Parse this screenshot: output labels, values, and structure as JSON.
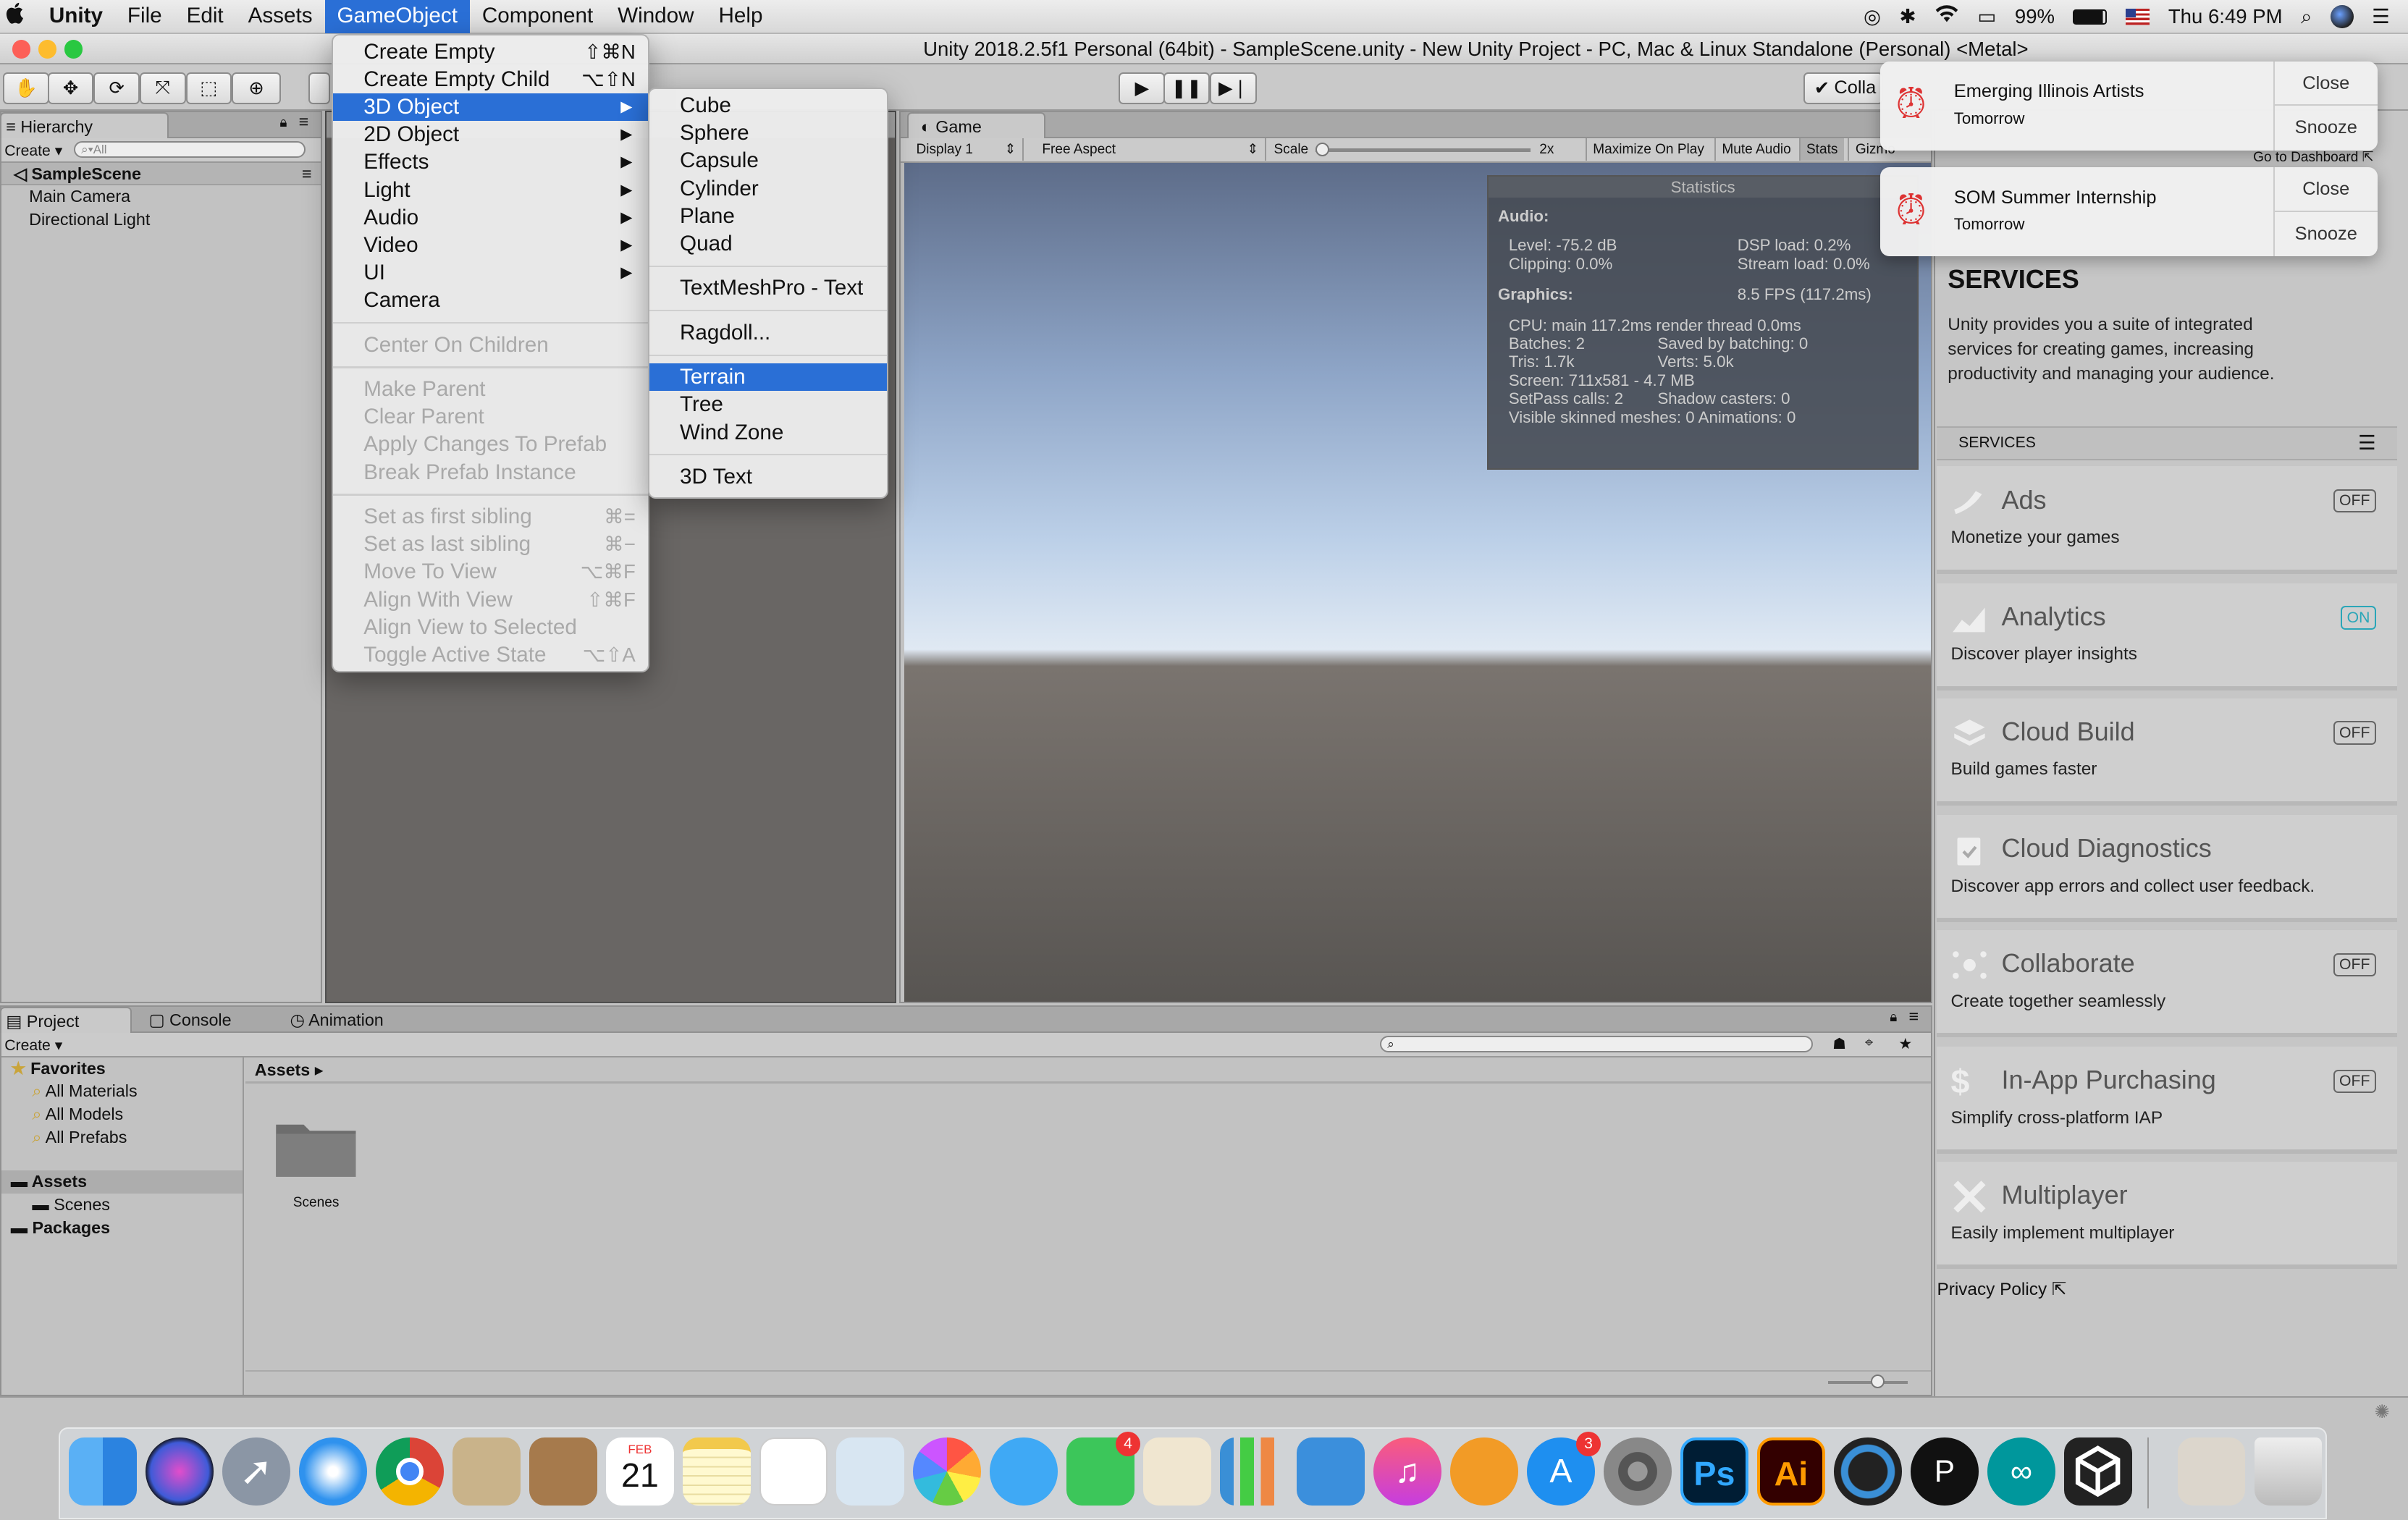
{
  "menubar": {
    "apple": "",
    "items": [
      "Unity",
      "File",
      "Edit",
      "Assets",
      "GameObject",
      "Component",
      "Window",
      "Help"
    ],
    "battery": "99%",
    "clock": "Thu 6:49 PM"
  },
  "window": {
    "title": "Unity 2018.2.5f1 Personal (64bit) - SampleScene.unity - New Unity Project - PC, Mac & Linux Standalone (Personal) <Metal>"
  },
  "toolbar": {
    "collab_label": "Colla"
  },
  "hierarchy": {
    "tab": "Hierarchy",
    "create": "Create",
    "search_placeholder": "All",
    "scene": "SampleScene",
    "items": [
      "Main Camera",
      "Directional Light"
    ]
  },
  "game": {
    "tab": "Game",
    "display": "Display 1",
    "aspect": "Free Aspect",
    "scale_label": "Scale",
    "scale_value": "2x",
    "maximize": "Maximize On Play",
    "mute": "Mute Audio",
    "stats": "Stats",
    "gizmos": "Gizmo"
  },
  "statistics": {
    "title": "Statistics",
    "audio_label": "Audio:",
    "level": "Level: -75.2 dB",
    "clipping": "Clipping: 0.0%",
    "dsp": "DSP load: 0.2%",
    "stream": "Stream load: 0.0%",
    "graphics_label": "Graphics:",
    "fps": "8.5 FPS (117.2ms)",
    "cpu": "CPU: main 117.2ms  render thread 0.0ms",
    "batches": "Batches: 2",
    "saved": "Saved by batching: 0",
    "tris": "Tris: 1.7k",
    "verts": "Verts: 5.0k",
    "screen": "Screen: 711x581 - 4.7 MB",
    "setpass": "SetPass calls: 2",
    "shadow": "Shadow casters: 0",
    "skinned": "Visible skinned meshes: 0  Animations: 0"
  },
  "gameobject_menu": {
    "group1": [
      {
        "label": "Create Empty",
        "shortcut": "⇧⌘N"
      },
      {
        "label": "Create Empty Child",
        "shortcut": "⌥⇧N"
      },
      {
        "label": "3D Object",
        "submenu": true,
        "highlighted": true
      },
      {
        "label": "2D Object",
        "submenu": true
      },
      {
        "label": "Effects",
        "submenu": true
      },
      {
        "label": "Light",
        "submenu": true
      },
      {
        "label": "Audio",
        "submenu": true
      },
      {
        "label": "Video",
        "submenu": true
      },
      {
        "label": "UI",
        "submenu": true
      },
      {
        "label": "Camera"
      }
    ],
    "group2": [
      {
        "label": "Center On Children"
      }
    ],
    "group3": [
      {
        "label": "Make Parent"
      },
      {
        "label": "Clear Parent"
      },
      {
        "label": "Apply Changes To Prefab"
      },
      {
        "label": "Break Prefab Instance"
      }
    ],
    "group4": [
      {
        "label": "Set as first sibling",
        "shortcut": "⌘="
      },
      {
        "label": "Set as last sibling",
        "shortcut": "⌘−"
      },
      {
        "label": "Move To View",
        "shortcut": "⌥⌘F"
      },
      {
        "label": "Align With View",
        "shortcut": "⇧⌘F"
      },
      {
        "label": "Align View to Selected"
      },
      {
        "label": "Toggle Active State",
        "shortcut": "⌥⇧A"
      }
    ]
  },
  "submenu_3d": {
    "items": [
      "Cube",
      "Sphere",
      "Capsule",
      "Cylinder",
      "Plane",
      "Quad",
      "TextMeshPro - Text",
      "Ragdoll...",
      "Terrain",
      "Tree",
      "Wind Zone",
      "3D Text"
    ]
  },
  "notifications": [
    {
      "title": "Emerging Illinois Artists",
      "subtitle": "Tomorrow",
      "close": "Close",
      "snooze": "Snooze"
    },
    {
      "title": "SOM Summer Internship",
      "subtitle": "Tomorrow",
      "close": "Close",
      "snooze": "Snooze"
    }
  ],
  "services": {
    "go_dashboard": "Go to Dashboard",
    "heading": "SERVICES",
    "intro": "Unity provides you a suite of integrated services for creating games, increasing productivity and managing your audience.",
    "section": "SERVICES",
    "items": [
      {
        "name": "Ads",
        "desc": "Monetize your games",
        "toggle": "OFF"
      },
      {
        "name": "Analytics",
        "desc": "Discover player insights",
        "toggle": "ON"
      },
      {
        "name": "Cloud Build",
        "desc": "Build games faster",
        "toggle": "OFF"
      },
      {
        "name": "Cloud Diagnostics",
        "desc": "Discover app errors and collect user feedback.",
        "toggle": ""
      },
      {
        "name": "Collaborate",
        "desc": "Create together seamlessly",
        "toggle": "OFF"
      },
      {
        "name": "In-App Purchasing",
        "desc": "Simplify cross-platform IAP",
        "toggle": "OFF"
      },
      {
        "name": "Multiplayer",
        "desc": "Easily implement multiplayer",
        "toggle": ""
      }
    ],
    "privacy": "Privacy Policy"
  },
  "project": {
    "tabs": [
      "Project",
      "Console",
      "Animation"
    ],
    "create": "Create",
    "favorites": "Favorites",
    "fav_items": [
      "All Materials",
      "All Models",
      "All Prefabs"
    ],
    "assets": "Assets",
    "scenes": "Scenes",
    "packages": "Packages",
    "breadcrumb": "Assets",
    "folder": "Scenes"
  },
  "dock": {
    "calendar_month": "FEB",
    "calendar_day": "21",
    "facetime_badge": "4",
    "appstore_badge": "3",
    "ps": "Ps",
    "ai": "Ai"
  }
}
